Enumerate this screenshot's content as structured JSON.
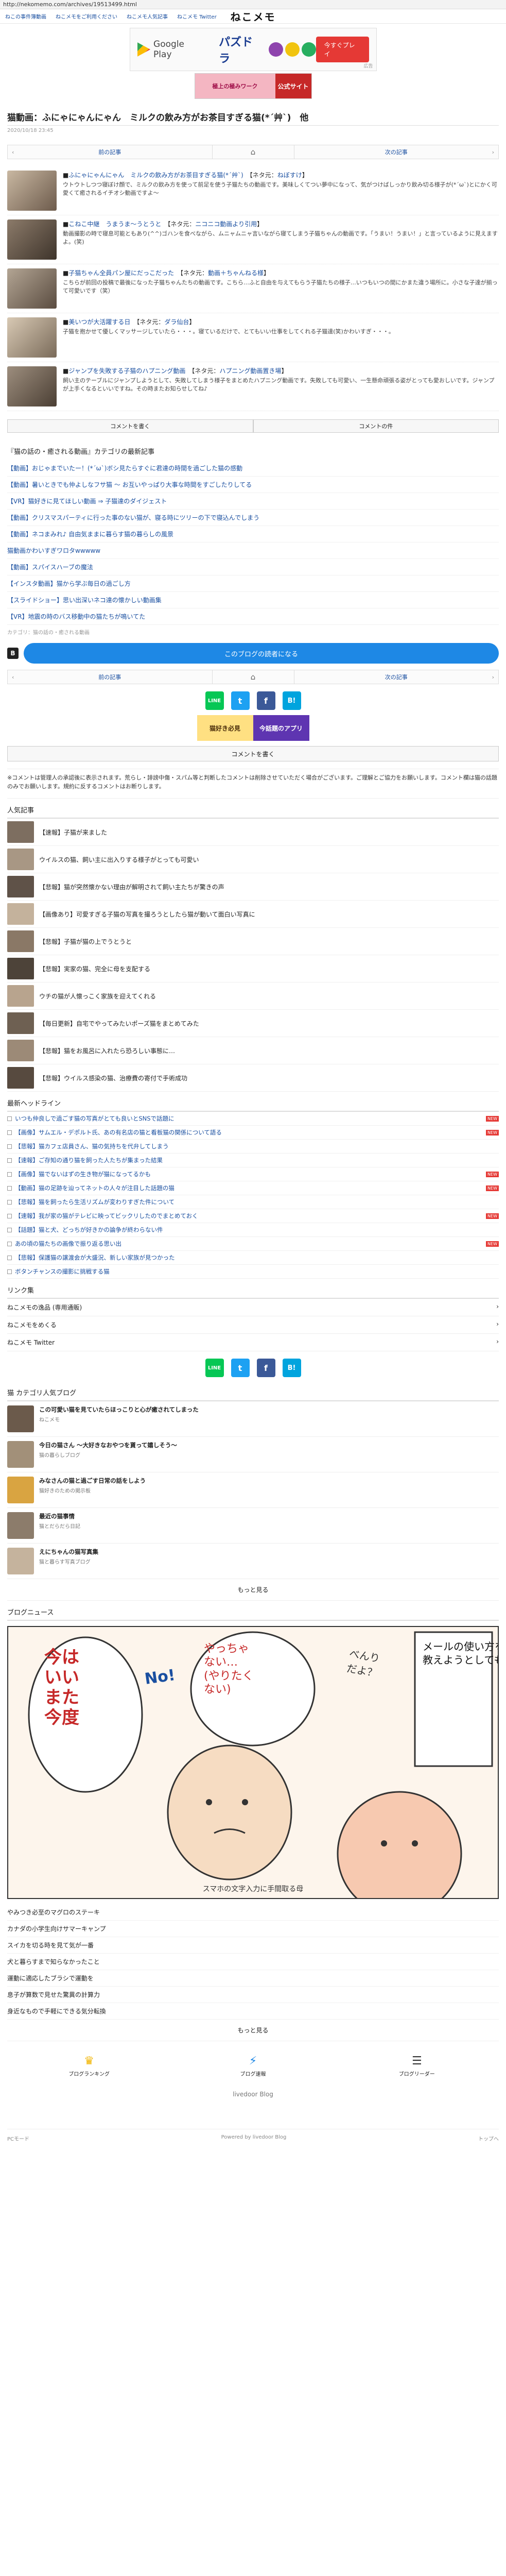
{
  "url": "http://nekomemo.com/archives/19513499.html",
  "nav": {
    "links": [
      "ねこの事件簿動画",
      "ねこメモをご利用ください",
      "ねこメモ人気記事",
      "ねこメモ Twitter"
    ],
    "logo": "ねこメモ"
  },
  "ad": {
    "store": "Google Play",
    "game": "パズドラ",
    "install": "今すぐプレイ",
    "tag": "広告",
    "small_left": "極上の極みワーク",
    "small_right": "公式サイト"
  },
  "article": {
    "title": "猫動画：ふにゃにゃんにゃん　ミルクの飲み方がお茶目すぎる猫(*´艸`)　他",
    "date": "2020/10/18 23:45"
  },
  "pager": {
    "prev": "前の記事",
    "home": "⌂",
    "next": "次の記事"
  },
  "entries": [
    {
      "title": "ふにゃにゃんにゃん　ミルクの飲み方がお茶目すぎる猫(*´艸`)",
      "tag": "【ネタ元：",
      "tag_link": "ねぼすけ",
      "tag_end": "】",
      "desc": "ウトウトしつつ寝ぼけ顔で、ミルクの飲み方を使って前足を使う子猫たちの動画です。美味しくてつい夢中になって、気がつけばしっかり飲み切る様子が(*´ω`)とにかく可愛くて癒されるイチオシ動画ですよ〜"
    },
    {
      "title": "こねこ中継　うまうま〜うとうと",
      "tag": "【ネタ元：",
      "tag_link": "ニコニコ動画より引用",
      "tag_end": "】",
      "desc": "動画撮影の時で寝息可能ともあり(^^)ゴハンを食べながら、ムニャムニャ言いながら寝てしまう子猫ちゃんの動画です。「うまい！うまい！」と言っているように見えますよ。(笑)"
    },
    {
      "title": "子猫ちゃん全員パン屋にだっこだった",
      "tag": "【ネタ元：",
      "tag_link": "動画＋ちゃんねる様",
      "tag_end": "】",
      "desc": "こちらが前回の投稿で最後になった子猫ちゃんたちの動画です。こちら…ふと自由を与えてもらう子猫たちの様子…いつもいつの間にかまた違う場所に。小さな子達が揃って可愛いです（笑）"
    },
    {
      "title": "美いつが大活躍する日",
      "tag": "【ネタ元：",
      "tag_link": "ダラ仙台",
      "tag_end": "】",
      "desc": "子猫を抱かせて優しくマッサージしていたら・・・。寝ているだけで、とてもいい仕事をしてくれる子猫達(笑)かわいすぎ・・・。"
    },
    {
      "title": "ジャンプを失敗する子猫のハプニング動画",
      "tag": "【ネタ元：",
      "tag_link": "ハプニング動画置き場",
      "tag_end": "】",
      "desc": "飼い主のテーブルにジャンプしようとして、失敗してしまう様子をまとめたハプニング動画です。失敗しても可愛い、一生懸命頑張る姿がとっても愛おしいです。ジャンプが上手くなるといいですね。その時またお知らせしてね♪"
    }
  ],
  "actions": {
    "comment": "コメントを書く",
    "comment_list": "コメントの件"
  },
  "related": {
    "heading": "『猫の話の・癒される動画』カテゴリの最新記事",
    "items": [
      "【動画】おじゃまでいたー！(*´ω`)ボシ見たらすぐに君達の時間を過ごした猫の感動",
      "【動画】暑いときでも仲よしなフサ猫 〜 お互いやっぱり大事な時間をすごしたりしてる",
      "【VR】猫好きに見てほしい動画 ⇒ 子猫達のダイジェスト",
      "【動画】クリスマスパーティに行った事のない猫が、寝る時にツリーの下で寝込んでしまう",
      "【動画】ネコまみれ♪ 自由気ままに暮らす猫の暮らしの風景",
      "猫動画かわいすぎワロタwwwww",
      "【動画】スパイスハーブの魔法",
      "【インスタ動画】猫から学ぶ毎日の過ごし方",
      "【スライドショー】思い出深いネコ達の懐かしい動画集",
      "【VR】地震の時のバス移動中の猫たちが鳴いてた"
    ],
    "category": "カテゴリ：猫の話の・癒される動画"
  },
  "follow": {
    "label": "このブログの読者になる",
    "b": "B"
  },
  "share": {
    "line": "LINE",
    "twitter": "t",
    "facebook": "f",
    "hatena": "B!"
  },
  "small_ad2": {
    "a": "猫好き必見",
    "b": "今話題のアプリ"
  },
  "comment_button": "コメントを書く",
  "notice": "※コメントは管理人の承認後に表示されます。荒らし・誹謗中傷・スパム等と判断したコメントは削除させていただく場合がございます。ご理解とご協力をお願いします。コメント欄は猫の話題のみでお願いします。規約に反するコメントはお断りします。",
  "popular": {
    "heading": "人気記事",
    "items": [
      "【速報】子猫が来ました",
      "ウイルスの猫、飼い主に出入りする様子がとっても可愛い",
      "【悲報】猫が突然懐かない理由が解明されて飼い主たちが驚きの声",
      "【画像あり】可愛すぎる子猫の写真を撮ろうとしたら猫が動いて面白い写真に",
      "【悲報】子猫が猫の上でうとうと",
      "【悲報】実家の猫、完全に母を支配する",
      "ウチの猫が人懐っこく家族を迎えてくれる",
      "【毎日更新】自宅でやってみたいポーズ猫をまとめてみた",
      "【悲報】猫をお風呂に入れたら恐ろしい事態に…",
      "【悲報】ウイルス感染の猫、治療費の寄付で手術成功"
    ]
  },
  "headlines": {
    "heading": "最新ヘッドライン",
    "items": [
      "いつも仲良しで過ごす猫の写真がとても良いとSNSで話題に",
      "【画像】サムエル・デポルト氏、あの有名店の猫と看板猫の関係について語る",
      "【悲報】猫カフェ店員さん、猫の気持ちを代弁してしまう",
      "【速報】ご存知の通り猫を飼った人たちが集まった結果",
      "【画像】猫でないはずの生き物が猫になってるかも",
      "【動画】猫の足跡を辿ってネットの人々が注目した話題の猫",
      "【悲報】猫を飼ったら生活リズムが変わりすぎた件について",
      "【速報】我が家の猫がテレビに映ってビックリしたのでまとめておく",
      "【話題】猫と犬、どっちが好きかの論争が終わらない件",
      "あの頃の猫たちの画像で振り返る思い出",
      "【悲報】保護猫の譲渡会が大盛況、新しい家族が見つかった",
      "ボタンチャンスの撮影に挑戦する猫"
    ]
  },
  "links": {
    "heading": "リンク集",
    "items": [
      "ねこメモの逸品 (専用通販)",
      "ねこメモをめくる",
      "ねこメモ Twitter"
    ]
  },
  "blog_ranking": {
    "heading": "猫 カテゴリ人気ブログ",
    "items": [
      {
        "t": "この可愛い猫を見ていたらほっこりと心が癒されてしまった",
        "s": "ねこメモ"
      },
      {
        "t": "今日の猫さん 〜大好きなおやつを貰って嬉しそう〜",
        "s": "猫の暮らしブログ"
      },
      {
        "t": "みなさんの猫と過ごす日常の話をしよう",
        "s": "猫好きのための掲示板"
      },
      {
        "t": "最近の猫事情",
        "s": "猫とだらだら日記"
      },
      {
        "t": "えにちゃんの猫写真集",
        "s": "猫と暮らす写真ブログ"
      }
    ],
    "more": "もっと見る"
  },
  "blog_news": {
    "heading": "ブログニュース",
    "comic": {
      "b1": "今は\nいい\nまた\n今度",
      "b2": "やっちゃ\nない…\n(やりたく\nない)",
      "b3": "メールの使い方を\n教えようとしても",
      "b4": "べんり\nだよ？",
      "no": "No!",
      "caption": "スマホの文字入力に手間取る母"
    },
    "items": [
      "やみつき必至のマグロのステーキ",
      "カナダの小学生向けサマーキャンプ",
      "スイカを切る時を見て気が一番",
      "犬と暮らすまで知らなかったこと",
      "運動に適応したブラシで運動を",
      "息子が算数で見せた驚異の計算力",
      "身近なもので手軽にできる気分転換"
    ],
    "more": "もっと見る"
  },
  "footer_tabs": {
    "ranking": "ブログランキング",
    "news": "ブログ速報",
    "reader": "ブログリーダー"
  },
  "powered": "livedoor Blog",
  "foot": {
    "left": "PCモード",
    "center": "Powered by livedoor Blog",
    "right": "トップへ"
  },
  "colors": {
    "accent": "#1e88e5",
    "link": "#1a4fa0",
    "line": "#06c755",
    "twitter": "#1da1f2",
    "facebook": "#3b5998",
    "hatena": "#00a4de"
  }
}
